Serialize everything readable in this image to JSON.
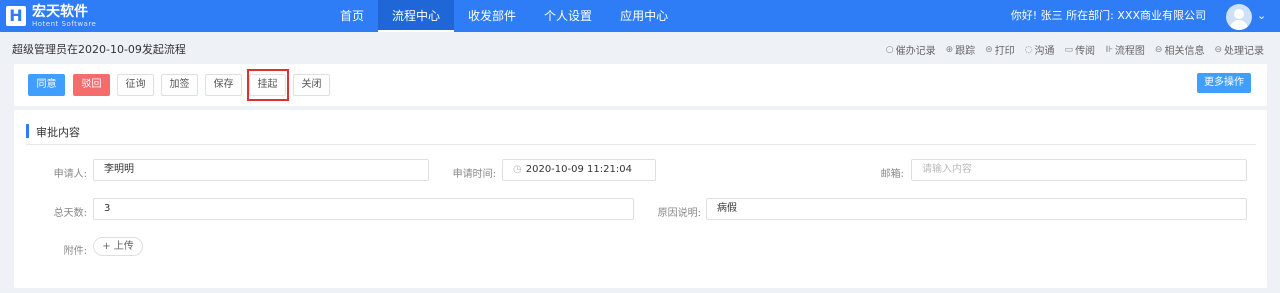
{
  "app": {
    "logo_mark": "H",
    "logo_name": "宏天软件",
    "logo_sub": "Hotent Software"
  },
  "nav": {
    "items": [
      "首页",
      "流程中心",
      "收发部件",
      "个人设置",
      "应用中心"
    ],
    "active": "流程中心"
  },
  "user": {
    "info": "你好! 张三 所在部门: XXX商业有限公司"
  },
  "breadcrumb": "超级管理员在2020-10-09发起流程",
  "tools": [
    {
      "icon": "○",
      "label": "催办记录"
    },
    {
      "icon": "⊕",
      "label": "跟踪"
    },
    {
      "icon": "⊜",
      "label": "打印"
    },
    {
      "icon": "◌",
      "label": "沟通"
    },
    {
      "icon": "▭",
      "label": "传阅"
    },
    {
      "icon": "⊪",
      "label": "流程图"
    },
    {
      "icon": "⊖",
      "label": "相关信息"
    },
    {
      "icon": "⊖",
      "label": "处理记录"
    }
  ],
  "toolbar": {
    "agree": "同意",
    "reject": "驳回",
    "consult": "征询",
    "add_sign": "加签",
    "save": "保存",
    "suspend": "挂起",
    "close": "关闭",
    "more": "更多操作"
  },
  "section": {
    "title": "审批内容"
  },
  "form": {
    "applicant_label": "申请人:",
    "applicant_value": "李明明",
    "apply_time_label": "申请时间:",
    "apply_time_value": "2020-10-09 11:21:04",
    "email_label": "邮箱:",
    "email_placeholder": "请输入内容",
    "days_label": "总天数:",
    "days_value": "3",
    "reason_label": "原因说明:",
    "reason_value": "病假",
    "attachment_label": "附件:",
    "upload_label": "+ 上传"
  },
  "colors": {
    "primary": "#2e7cf6",
    "button_primary": "#409eff",
    "button_danger": "#f56c6c",
    "highlight": "#e03030"
  }
}
